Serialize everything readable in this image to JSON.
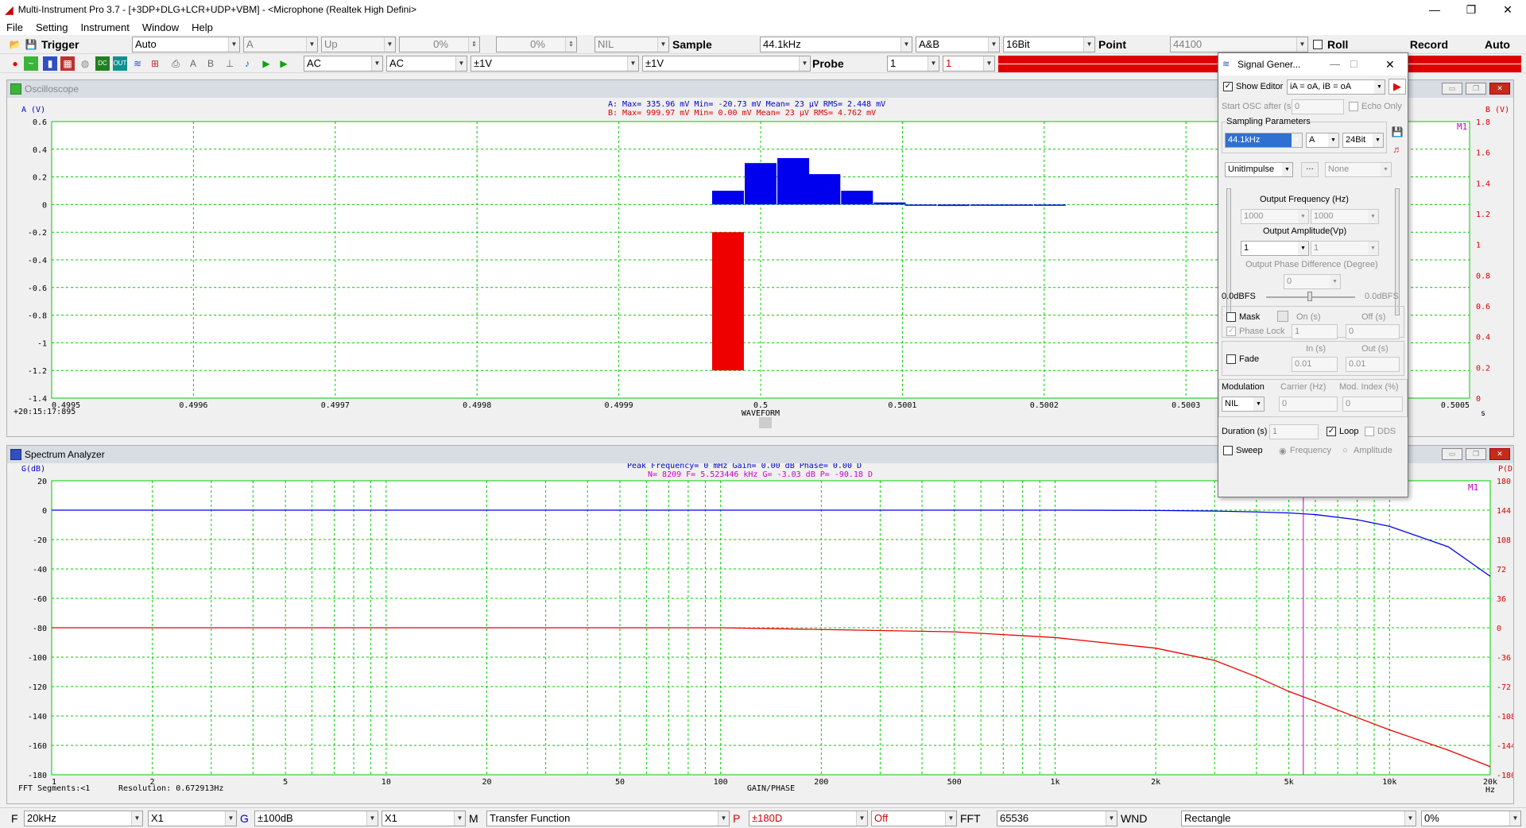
{
  "window": {
    "title": "Multi-Instrument Pro 3.7   -   [+3DP+DLG+LCR+UDP+VBM]   -   <Microphone (Realtek High Defini>",
    "min": "—",
    "max": "❐",
    "close": "✕"
  },
  "menu": [
    "File",
    "Setting",
    "Instrument",
    "Window",
    "Help"
  ],
  "toolbar1": {
    "trigger_label": "Trigger",
    "trigger_mode": "Auto",
    "channel": "A",
    "edge": "Up",
    "pct1": "0%",
    "pct2": "0%",
    "nil": "NIL",
    "sample_label": "Sample",
    "sample_rate": "44.1kHz",
    "chan_sel": "A&B",
    "bits": "16Bit",
    "point_label": "Point",
    "points": "44100",
    "roll": "Roll",
    "record": "Record",
    "auto": "Auto"
  },
  "toolbar2": {
    "coupling_a": "AC",
    "coupling_b": "AC",
    "range_a": "±1V",
    "range_b": "±1V",
    "probe_label": "Probe",
    "probe_a": "1",
    "probe_b": "1"
  },
  "oscilloscope": {
    "title": "Oscilloscope",
    "y_left_label": "A (V)",
    "y_right_label": "B (V)",
    "x_label": "WAVEFORM",
    "x_unit": "s",
    "timestamp": "+20:15:17:895",
    "marker": "M1",
    "stats_a": "A: Max=   335.96 mV  Min=   -20.73 mV  Mean=       23 μV  RMS=    2.448 mV",
    "stats_b": "B: Max=   999.97 mV  Min=     0.00 mV  Mean=       23 μV  RMS=    4.762 mV",
    "y_ticks_left": [
      "0.6",
      "0.4",
      "0.2",
      "0",
      "-0.2",
      "-0.4",
      "-0.6",
      "-0.8",
      "-1",
      "-1.2",
      "-1.4"
    ],
    "y_ticks_right": [
      "1.8",
      "1.6",
      "1.4",
      "1.2",
      "1",
      "0.8",
      "0.6",
      "0.4",
      "0.2",
      "0"
    ],
    "x_ticks": [
      "0.4995",
      "0.4996",
      "0.4997",
      "0.4998",
      "0.4999",
      "0.5",
      "0.5001",
      "0.5002",
      "0.5003",
      "0.5005"
    ],
    "colors": {
      "grid": "#00cc00",
      "a": "#0000ee",
      "b": "#ee0000"
    }
  },
  "chart_data": [
    {
      "type": "bar",
      "title": "Oscilloscope",
      "xlabel": "WAVEFORM",
      "ylabel": "A (V)",
      "xlim": [
        0.4995,
        0.5005
      ],
      "ylim": [
        -1.4,
        0.6
      ],
      "grid": true,
      "series": [
        {
          "name": "A",
          "x": [
            0.499977,
            0.5,
            0.500023,
            0.500045,
            0.500068,
            0.500091,
            0.500113,
            0.500136,
            0.500159,
            0.500181,
            0.500204
          ],
          "values": [
            0.1,
            0.3,
            0.336,
            0.22,
            0.1,
            0.015,
            -0.005,
            -0.01,
            -0.008,
            -0.005,
            -0.003
          ]
        },
        {
          "name": "B",
          "x": [
            0.499977
          ],
          "values": [
            1.0
          ]
        }
      ]
    },
    {
      "type": "line",
      "title": "Spectrum Analyzer",
      "xlabel": "GAIN/PHASE",
      "ylabel": "G(dB)",
      "x_scale": "log",
      "xlim": [
        1,
        20000
      ],
      "ylim": [
        -180,
        20
      ],
      "y2label": "P(D)",
      "y2lim": [
        -180,
        180
      ],
      "grid": true,
      "series": [
        {
          "name": "Gain",
          "x": [
            1,
            100,
            1000,
            2000,
            3000,
            4000,
            5000,
            6000,
            8000,
            10000,
            15000,
            20000
          ],
          "values": [
            0,
            0,
            0,
            -0.2,
            -0.6,
            -1.2,
            -1.9,
            -3.0,
            -6.5,
            -11,
            -25,
            -45
          ]
        },
        {
          "name": "Phase",
          "x": [
            1,
            100,
            500,
            1000,
            2000,
            3000,
            4000,
            5000,
            6000,
            8000,
            10000,
            15000,
            20000
          ],
          "values": [
            0,
            0,
            -5,
            -12,
            -25,
            -40,
            -60,
            -78,
            -90,
            -110,
            -125,
            -150,
            -170
          ]
        }
      ]
    }
  ],
  "spectrum": {
    "title": "Spectrum Analyzer",
    "y_left_label": "G(dB)",
    "y_right_label": "P(D)",
    "x_label": "GAIN/PHASE",
    "x_unit": "Hz",
    "marker": "M1",
    "peak": "Peak Frequency=        0 mHz  Gain=   0.00 dB  Phase=   0.00 D",
    "cursor": "N= 8209   F= 5.523446 kHz  G=  -3.03 dB  P= -90.18 D",
    "segments": "FFT Segments:<1",
    "resolution": "Resolution: 0.672913Hz",
    "y_ticks_left": [
      "20",
      "0",
      "-20",
      "-40",
      "-60",
      "-80",
      "-100",
      "-120",
      "-140",
      "-160",
      "-180"
    ],
    "y_ticks_right": [
      "180",
      "144",
      "108",
      "72",
      "36",
      "0",
      "-36",
      "-72",
      "-108",
      "-144",
      "-180"
    ],
    "x_ticks": [
      "1",
      "2",
      "5",
      "10",
      "20",
      "50",
      "100",
      "200",
      "500",
      "1k",
      "2k",
      "5k",
      "10k",
      "20k"
    ],
    "colors": {
      "grid": "#00cc00",
      "gain": "#0000ee",
      "phase": "#ee0000",
      "cursor": "#cc00cc"
    }
  },
  "siggen": {
    "title": "Signal Gener...",
    "show_editor": "Show Editor",
    "formula": "iA = oA, iB = oA",
    "start_osc": "Start OSC after (s)",
    "start_val": "0",
    "echo_only": "Echo Only",
    "sampling_params": "Sampling Parameters",
    "sample_rate": "44.1kHz",
    "channel": "A",
    "bits": "24Bit",
    "waveform": "UnitImpulse",
    "waveform2": "None",
    "out_freq": "Output Frequency (Hz)",
    "freq_a": "1000",
    "freq_b": "1000",
    "out_amp": "Output Amplitude(Vp)",
    "amp_a": "1",
    "amp_b": "1",
    "phase_diff": "Output Phase Difference (Degree)",
    "phase_val": "0",
    "dbfs_left": "0.0dBFS",
    "dbfs_right": "0.0dBFS",
    "mask": "Mask",
    "on_s": "On (s)",
    "off_s": "Off (s)",
    "phase_lock": "Phase Lock",
    "on_val": "1",
    "off_val": "0",
    "fade": "Fade",
    "in_s": "In (s)",
    "out_s": "Out (s)",
    "in_val": "0.01",
    "out_val": "0.01",
    "modulation": "Modulation",
    "carrier": "Carrier (Hz)",
    "mod_index": "Mod. Index (%)",
    "mod_sel": "NIL",
    "carrier_val": "0",
    "mod_index_val": "0",
    "duration": "Duration (s)",
    "duration_val": "1",
    "loop": "Loop",
    "dds": "DDS",
    "sweep": "Sweep",
    "frequency": "Frequency",
    "amplitude": "Amplitude"
  },
  "bottom": {
    "f_label": "F",
    "f_val": "20kHz",
    "f_mult": "X1",
    "g_label": "G",
    "g_val": "±100dB",
    "g_mult": "X1",
    "m_label": "M",
    "m_val": "Transfer Function",
    "p_label": "P",
    "p_val": "±180D",
    "p_off": "Off",
    "fft_label": "FFT",
    "fft_val": "65536",
    "wnd_label": "WND",
    "wnd_val": "Rectangle",
    "pct": "0%"
  }
}
